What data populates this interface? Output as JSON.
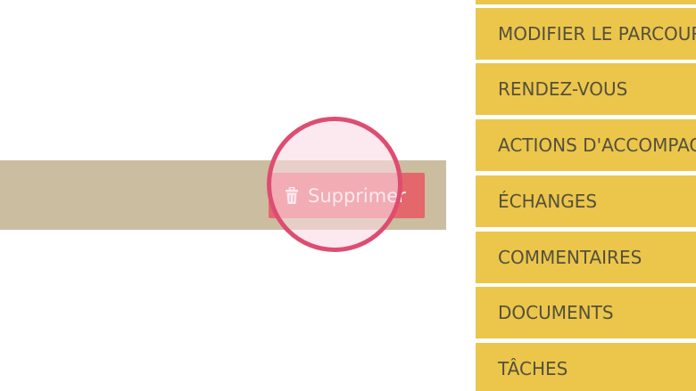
{
  "row": {
    "delete_label": "Supprimer"
  },
  "menu": {
    "items": [
      {
        "label": "MODIFIER LE PARCOURS"
      },
      {
        "label": "RENDEZ-VOUS"
      },
      {
        "label": "ACTIONS D'ACCOMPAGNEMENT"
      },
      {
        "label": "ÉCHANGES"
      },
      {
        "label": "COMMENTAIRES"
      },
      {
        "label": "DOCUMENTS"
      },
      {
        "label": "TÂCHES"
      }
    ]
  },
  "colors": {
    "menu_background": "#ebc64b",
    "menu_text": "#55503c",
    "row_background": "#cbbd9f",
    "delete_button": "#e4676c",
    "highlight_ring": "#de4d71"
  },
  "icons": {
    "delete": "trash-icon"
  }
}
